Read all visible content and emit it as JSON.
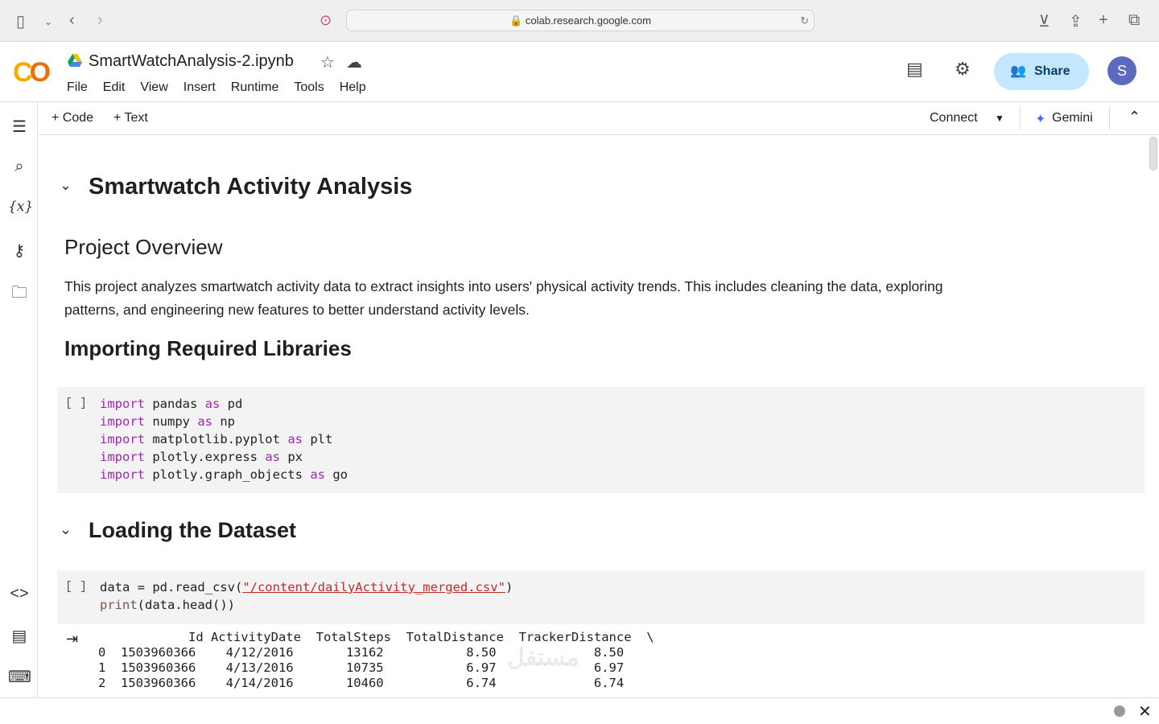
{
  "browser": {
    "url": "colab.research.google.com"
  },
  "header": {
    "logo": "CO",
    "title": "SmartWatchAnalysis-2.ipynb",
    "menu": [
      "File",
      "Edit",
      "View",
      "Insert",
      "Runtime",
      "Tools",
      "Help"
    ],
    "share": "Share",
    "avatar": "S"
  },
  "toolbar": {
    "code": "+ Code",
    "text": "+ Text",
    "connect": "Connect",
    "gemini": "Gemini"
  },
  "notebook": {
    "h1": "Smartwatch Activity Analysis",
    "overview_title": "Project Overview",
    "overview_text": "This project analyzes smartwatch activity data to extract insights into users' physical activity trends. This includes cleaning the data, exploring patterns, and engineering new features to better understand activity levels.",
    "libs_title": "Importing Required Libraries",
    "cell_bracket": "[ ]",
    "imports": [
      [
        "import",
        "pandas",
        "as",
        "pd"
      ],
      [
        "import",
        "numpy",
        "as",
        "np"
      ],
      [
        "import",
        "matplotlib.pyplot",
        "as",
        "plt"
      ],
      [
        "import",
        "plotly.express",
        "as",
        "px"
      ],
      [
        "import",
        "plotly.graph_objects",
        "as",
        "go"
      ]
    ],
    "load_title": "Loading the Dataset",
    "load_code": {
      "a": "data = pd.read_csv(",
      "s": "\"/content/dailyActivity_merged.csv\"",
      "b": ")",
      "print": "print",
      "c": "(data.head())"
    },
    "output": "            Id ActivityDate  TotalSteps  TotalDistance  TrackerDistance  \\\n0  1503960366    4/12/2016       13162           8.50             8.50\n1  1503960366    4/13/2016       10735           6.97             6.97\n2  1503960366    4/14/2016       10460           6.74             6.74"
  },
  "watermark": "mostaql.com"
}
